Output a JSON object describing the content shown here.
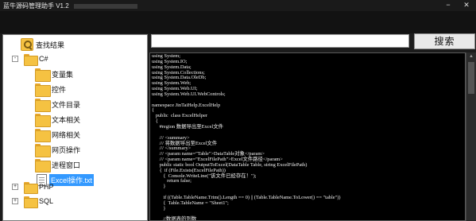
{
  "window": {
    "title": "蓝牛源码管理助手 V1.2",
    "min_label": "−",
    "close_label": "✕"
  },
  "search": {
    "button_label": "搜索",
    "value": ""
  },
  "tree": {
    "root": {
      "label": "查找结果"
    },
    "nodes": [
      {
        "label": "C#",
        "expanded": true
      },
      {
        "label": "变量集"
      },
      {
        "label": "控件"
      },
      {
        "label": "文件目录"
      },
      {
        "label": "文本相关"
      },
      {
        "label": "网络相关"
      },
      {
        "label": "网页操作"
      },
      {
        "label": "进程窗口"
      },
      {
        "label": "Excel操作.txt",
        "selected": true
      },
      {
        "label": "PHP",
        "expanded": false
      },
      {
        "label": "SQL",
        "expanded": false
      }
    ],
    "expand_symbol": "-",
    "collapse_symbol": "+"
  },
  "code": {
    "lines": [
      "using System;",
      "using System.IO;",
      "using System.Data;",
      "using System.Collections;",
      "using System.Data.OleDb;",
      "using System.Web;",
      "using System.Web.UI;",
      "using System.Web.UI.WebControls;",
      "",
      "namespace JinTaiHelp.ExcelHelp",
      "{",
      "   public  class ExcelHelper",
      "   {",
      "      #region 数据导出至Excel文件",
      "",
      "      /// <summary>",
      "      /// 将数据导出至Excel文件",
      "      /// </summary>",
      "      /// <param name=\"Table\">DataTable对象</param>",
      "      /// <param name=\"ExcelFilePath\">Excel文件路径</param>",
      "      public static bool OutputToExcel(DataTable Table, string ExcelFilePath)",
      "      {  if (File.Exists(ExcelFilePath))",
      "         {  Console.WriteLine(\"该文件已经存在！\");",
      "            return false;",
      "         }",
      "",
      "         if ((Table.TableName.Trim().Length == 0) || (Table.TableName.ToLower() == \"table\"))",
      "         {  Table.TableName = \"Sheet1\";",
      "         }",
      "",
      "         //数据表的列数"
    ]
  }
}
